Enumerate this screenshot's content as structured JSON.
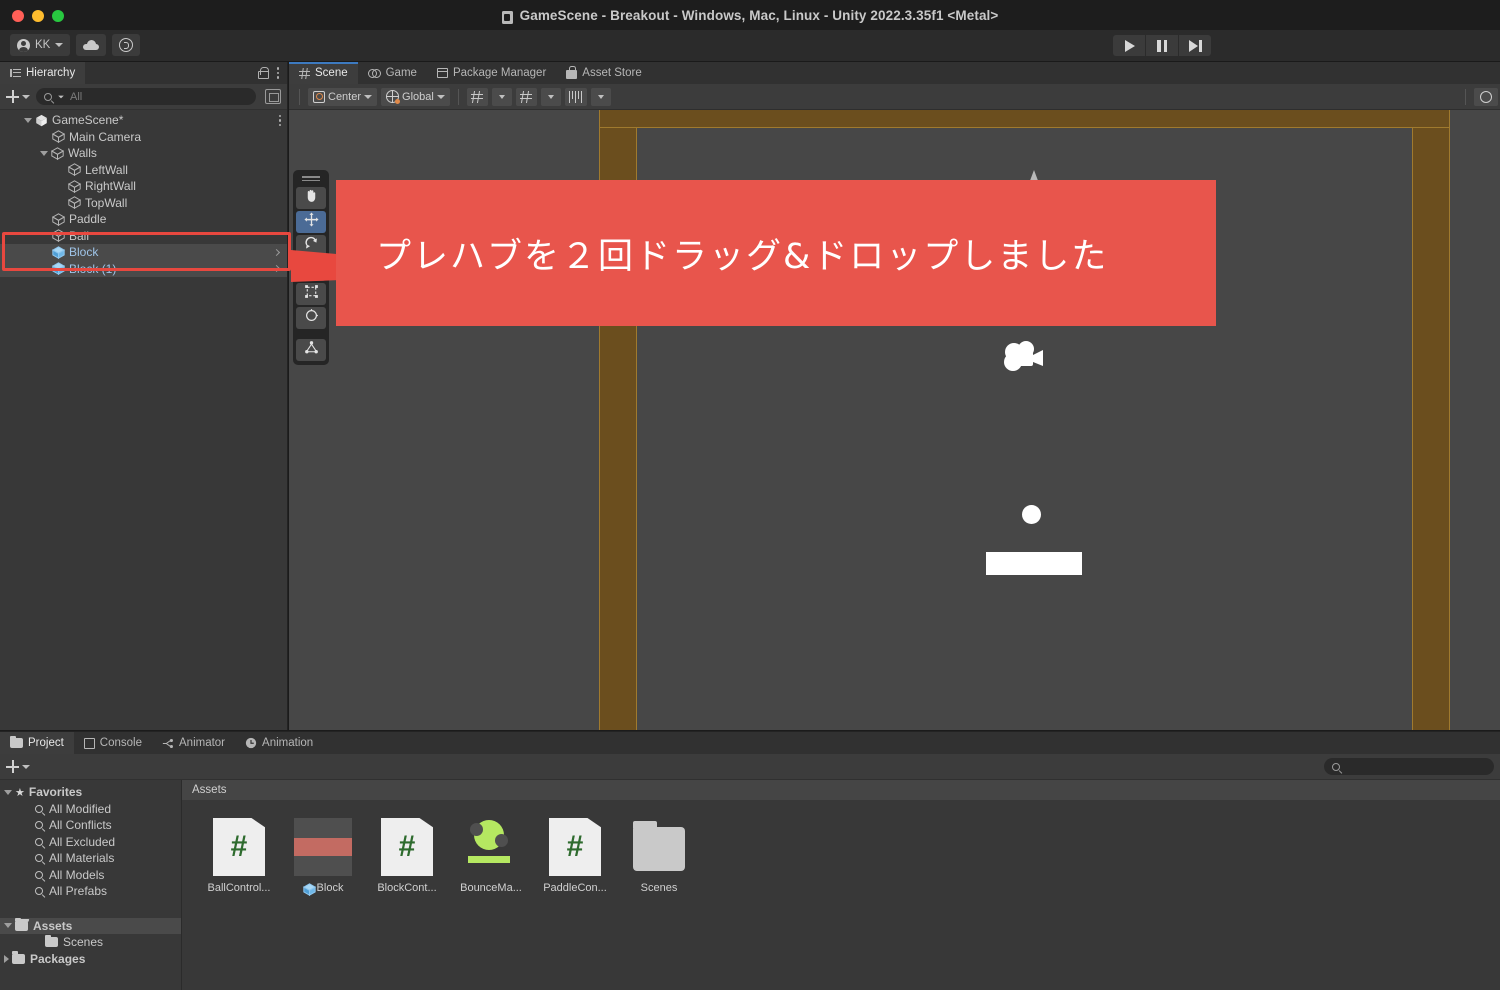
{
  "window": {
    "title": "GameScene - Breakout - Windows, Mac, Linux - Unity 2022.3.35f1 <Metal>"
  },
  "main_toolbar": {
    "account_label": "KK",
    "account_icon": "avatar-icon",
    "cloud_icon": "cloud-icon",
    "services_icon": "unity-services-icon",
    "play_icon": "play-icon",
    "pause_icon": "pause-icon",
    "step_icon": "step-icon"
  },
  "hierarchy": {
    "tab_label": "Hierarchy",
    "tab_icon": "hierarchy-icon",
    "lock_icon": "lock-icon",
    "menu_icon": "kebab-menu-icon",
    "add_label": "+",
    "search_placeholder": "All",
    "search_icon": "search-icon",
    "extra_icon": "visibility-icon",
    "items": [
      {
        "label": "GameScene*",
        "depth": 0,
        "arrow": "expanded",
        "icon": "unity-scene-icon",
        "selected": false,
        "menu": true
      },
      {
        "label": "Main Camera",
        "depth": 1,
        "arrow": "none",
        "icon": "gameobject-icon",
        "selected": false,
        "menu": false
      },
      {
        "label": "Walls",
        "depth": 1,
        "arrow": "expanded",
        "icon": "gameobject-icon",
        "selected": false,
        "menu": false
      },
      {
        "label": "LeftWall",
        "depth": 2,
        "arrow": "none",
        "icon": "gameobject-icon",
        "selected": false,
        "menu": false
      },
      {
        "label": "RightWall",
        "depth": 2,
        "arrow": "none",
        "icon": "gameobject-icon",
        "selected": false,
        "menu": false
      },
      {
        "label": "TopWall",
        "depth": 2,
        "arrow": "none",
        "icon": "gameobject-icon",
        "selected": false,
        "menu": false
      },
      {
        "label": "Paddle",
        "depth": 1,
        "arrow": "none",
        "icon": "gameobject-icon",
        "selected": false,
        "menu": false
      },
      {
        "label": "Ball",
        "depth": 1,
        "arrow": "none",
        "icon": "gameobject-icon",
        "selected": false,
        "menu": false
      },
      {
        "label": "Block",
        "depth": 1,
        "arrow": "none",
        "icon": "prefab-icon",
        "selected": true,
        "menu": false,
        "chevron": true
      },
      {
        "label": "Block (1)",
        "depth": 1,
        "arrow": "none",
        "icon": "prefab-icon",
        "selected": true,
        "menu": false,
        "chevron": true
      }
    ]
  },
  "scene": {
    "tabs": [
      {
        "label": "Scene",
        "icon": "scene-grid-icon",
        "active": true
      },
      {
        "label": "Game",
        "icon": "game-controller-icon",
        "active": false
      },
      {
        "label": "Package Manager",
        "icon": "package-icon",
        "active": false
      },
      {
        "label": "Asset Store",
        "icon": "store-bag-icon",
        "active": false
      }
    ],
    "toolbar": {
      "pivot_label": "Center",
      "pivot_icon": "pivot-center-icon",
      "handle_label": "Global",
      "handle_icon": "globe-icon",
      "grid_snap_icon": "grid-snapping-icon",
      "snap_increment_icon": "snap-increment-icon",
      "ruler_icon": "ruler-icon",
      "dropdown_icon": "chevron-down-icon"
    },
    "tools": [
      {
        "name": "hand-tool",
        "icon": "hand-icon",
        "active": false
      },
      {
        "name": "move-tool",
        "icon": "move-arrows-icon",
        "active": true
      },
      {
        "name": "rotate-tool",
        "icon": "rotate-icon",
        "active": false
      },
      {
        "name": "scale-tool",
        "icon": "scale-icon",
        "active": false
      },
      {
        "name": "rect-tool",
        "icon": "rect-transform-icon",
        "active": false
      },
      {
        "name": "transform-tool",
        "icon": "transform-icon",
        "active": false
      },
      {
        "name": "custom-tool",
        "icon": "custom-editor-tool-icon",
        "active": false
      }
    ],
    "objects": {
      "selected_block": "Block",
      "gizmo_y_axis_color": "#b9b9b9",
      "gizmo_x_axis_color": "#e3e14a",
      "wall_color": "#6b4e1e",
      "wall_outline_color": "#a07a2e",
      "block_fill_color": "#c36b62",
      "block_outline_color": "#e8a24a",
      "ball_color": "#ffffff",
      "paddle_color": "#ffffff",
      "camera_icon": "camera-gizmo-icon",
      "viewport_bg_color": "#474747"
    }
  },
  "annotation": {
    "banner_text": "プレハブを２回ドラッグ&ドロップしました",
    "banner_color": "#e8554c",
    "highlight_color": "#e8483f"
  },
  "project": {
    "tabs": [
      {
        "label": "Project",
        "icon": "folder-icon",
        "active": true
      },
      {
        "label": "Console",
        "icon": "console-icon",
        "active": false
      },
      {
        "label": "Animator",
        "icon": "animator-icon",
        "active": false
      },
      {
        "label": "Animation",
        "icon": "clock-icon",
        "active": false
      }
    ],
    "add_label": "+",
    "search_icon": "search-icon",
    "search_value": "",
    "sidebar": [
      {
        "label": "Favorites",
        "type": "root",
        "arrow": "expanded",
        "icon": "star-icon",
        "selected": false
      },
      {
        "label": "All Modified",
        "type": "search",
        "arrow": "none",
        "icon": "search-icon",
        "selected": false
      },
      {
        "label": "All Conflicts",
        "type": "search",
        "arrow": "none",
        "icon": "search-icon",
        "selected": false
      },
      {
        "label": "All Excluded",
        "type": "search",
        "arrow": "none",
        "icon": "search-icon",
        "selected": false
      },
      {
        "label": "All Materials",
        "type": "search",
        "arrow": "none",
        "icon": "search-icon",
        "selected": false
      },
      {
        "label": "All Models",
        "type": "search",
        "arrow": "none",
        "icon": "search-icon",
        "selected": false
      },
      {
        "label": "All Prefabs",
        "type": "search",
        "arrow": "none",
        "icon": "search-icon",
        "selected": false
      },
      {
        "label": "",
        "type": "spacer",
        "arrow": "none",
        "icon": "",
        "selected": false
      },
      {
        "label": "Assets",
        "type": "folder-open",
        "arrow": "expanded",
        "icon": "folder-open-icon",
        "selected": true
      },
      {
        "label": "Scenes",
        "type": "folder-child",
        "arrow": "none",
        "icon": "folder-icon",
        "selected": false
      },
      {
        "label": "Packages",
        "type": "folder",
        "arrow": "collapsed",
        "icon": "folder-icon",
        "selected": false
      }
    ],
    "breadcrumb": "Assets",
    "assets": [
      {
        "label": "BallControl...",
        "type": "script",
        "badge": ""
      },
      {
        "label": "Block",
        "type": "prefab",
        "badge": "prefab-cube-icon"
      },
      {
        "label": "BlockCont...",
        "type": "script",
        "badge": ""
      },
      {
        "label": "BounceMa...",
        "type": "physics-material",
        "badge": ""
      },
      {
        "label": "PaddleCon...",
        "type": "script",
        "badge": ""
      },
      {
        "label": "Scenes",
        "type": "folder",
        "badge": ""
      }
    ]
  }
}
